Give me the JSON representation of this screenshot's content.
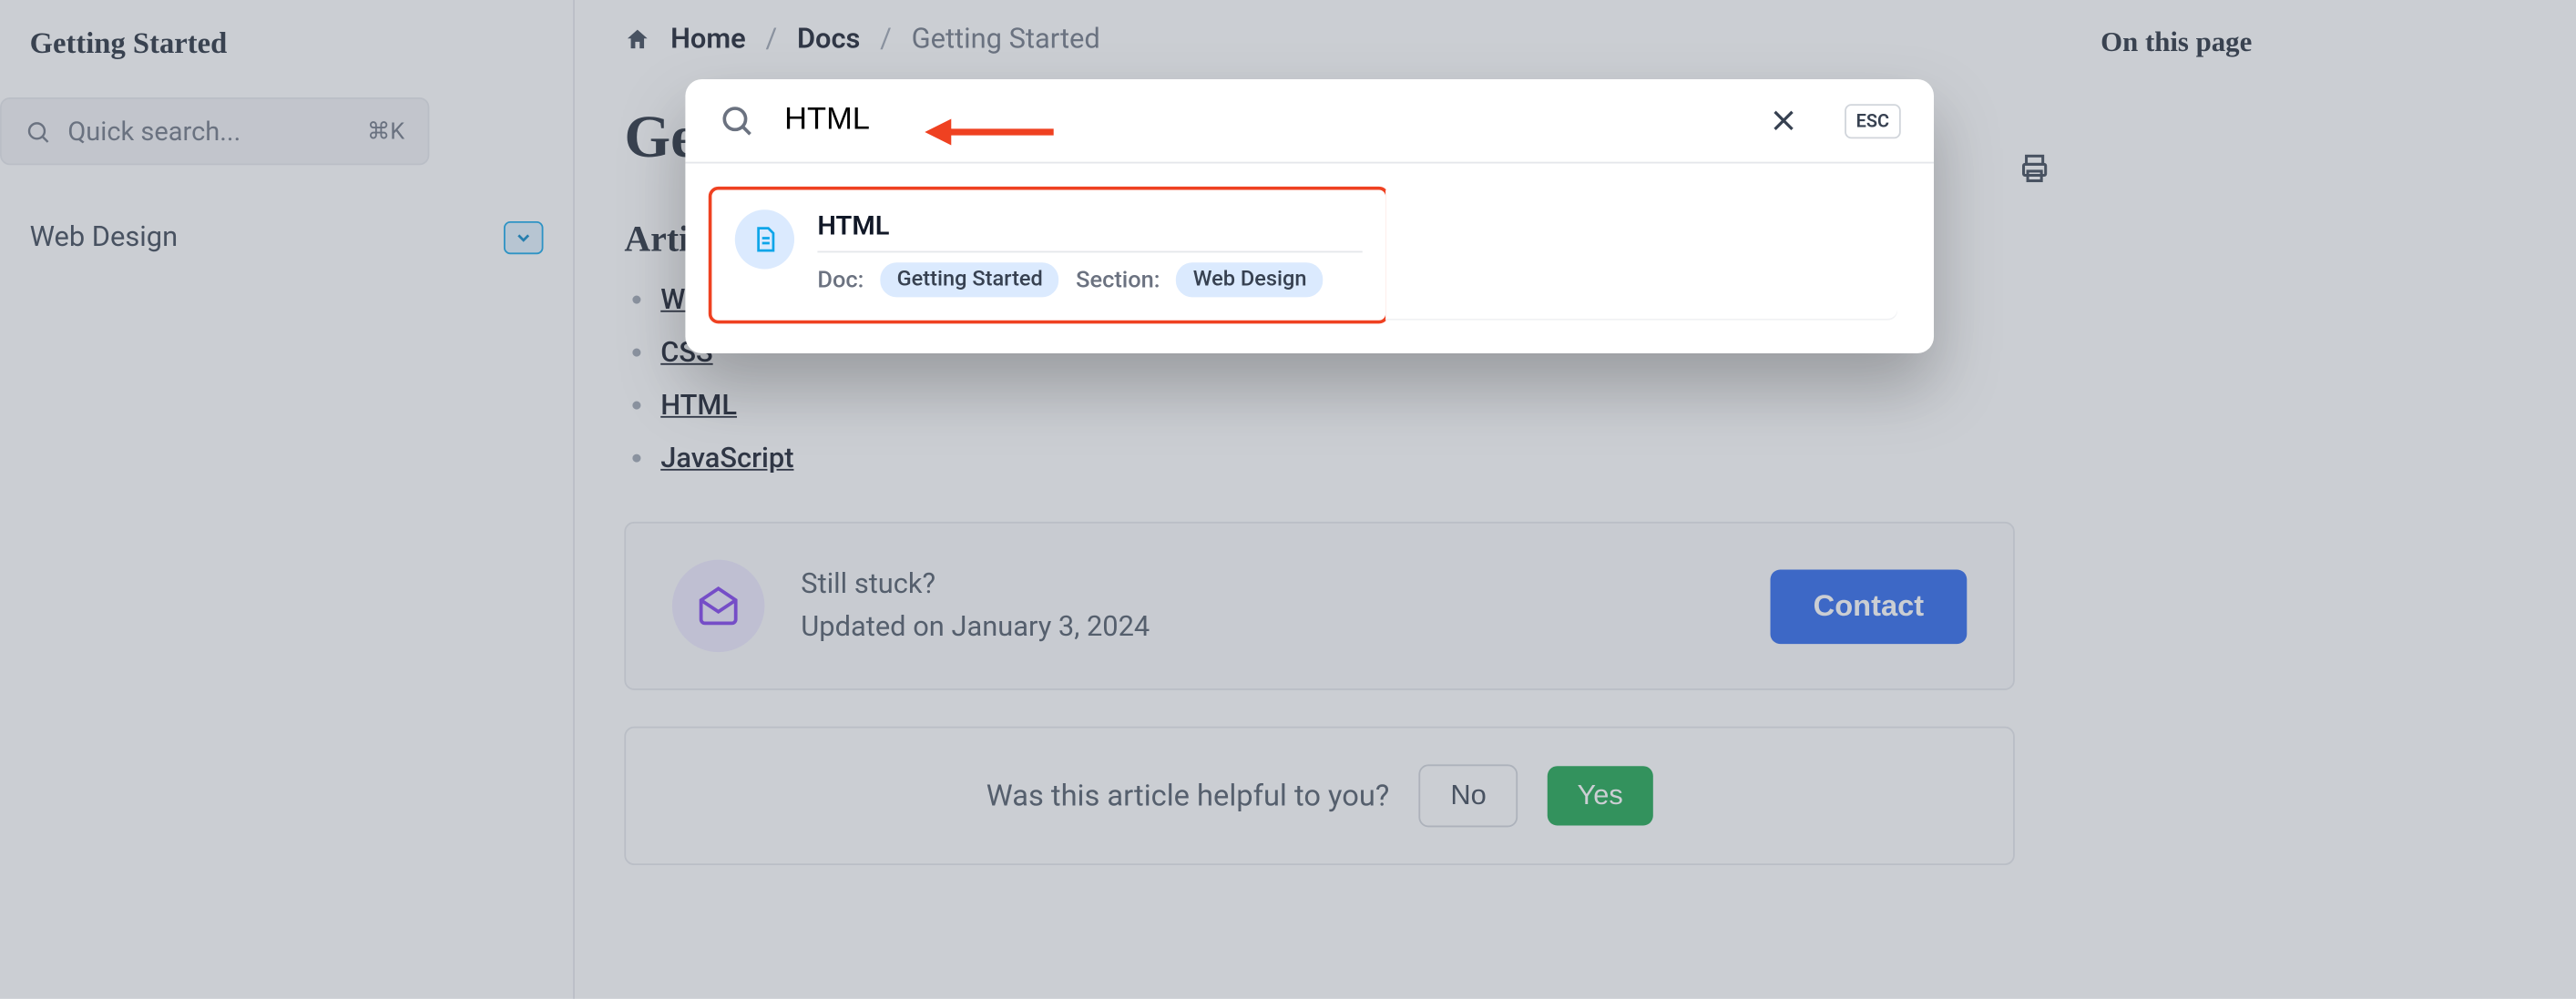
{
  "sidebar": {
    "title": "Getting Started",
    "search_placeholder": "Quick search...",
    "search_shortcut": "⌘K",
    "items": [
      {
        "label": "Web Design"
      }
    ]
  },
  "breadcrumb": {
    "home": "Home",
    "docs": "Docs",
    "current": "Getting Started"
  },
  "page_title": "Getting Started",
  "section_heading": "Articles",
  "articles": [
    "Web Design",
    "CSS",
    "HTML",
    "JavaScript"
  ],
  "stuck": {
    "question": "Still stuck?",
    "updated": "Updated on January 3, 2024",
    "contact": "Contact"
  },
  "helpful": {
    "question": "Was this article helpful to you?",
    "no": "No",
    "yes": "Yes"
  },
  "rightcol": {
    "title": "On this page"
  },
  "modal": {
    "search_value": "HTML",
    "close_aria": "Close",
    "esc_label": "ESC",
    "result": {
      "title": "HTML",
      "doc_label": "Doc:",
      "doc_chip": "Getting Started",
      "section_label": "Section:",
      "section_chip": "Web Design"
    }
  },
  "icons": {
    "search": "search-icon",
    "chevron_down": "chevron-down-icon",
    "home": "home-icon",
    "print": "printer-icon",
    "envelope": "envelope-open-icon",
    "close": "close-icon",
    "document": "document-icon"
  }
}
